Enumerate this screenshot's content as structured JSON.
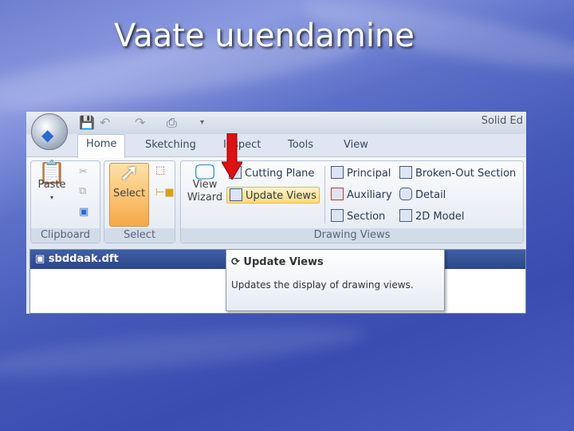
{
  "slide": {
    "title": "Vaate uuendamine"
  },
  "app": {
    "title": "Solid Ed",
    "tabs": [
      "Home",
      "Sketching",
      "Inspect",
      "Tools",
      "View"
    ],
    "groups": {
      "clipboard": {
        "label": "Clipboard",
        "paste": "Paste"
      },
      "select": {
        "label": "Select",
        "select": "Select"
      },
      "drawing_views": {
        "label": "Drawing Views",
        "view_wizard_1": "View",
        "view_wizard_2": "Wizard",
        "items": [
          "Cutting Plane",
          "Update Views",
          "Principal",
          "Auxiliary",
          "Section",
          "Broken-Out Section",
          "Detail",
          "2D Model"
        ]
      }
    },
    "document": {
      "filename": "sbddaak.dft"
    },
    "tooltip": {
      "title": "Update Views",
      "description": "Updates the display of drawing views."
    }
  }
}
